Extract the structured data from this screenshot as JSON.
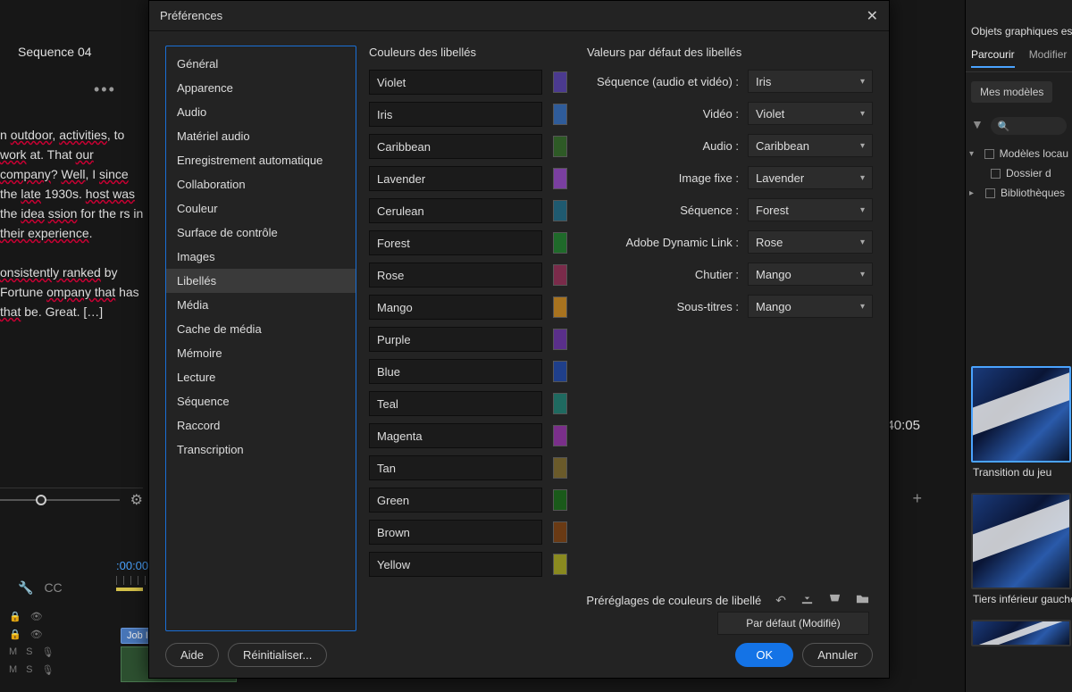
{
  "bg": {
    "sequence_tab": "Sequence 04",
    "ellipsis": "•••",
    "text_html": "n <u>outdoor</u>, <u>activities</u>, to <u>work</u> at. That <u>our company</u>? <u>Well</u>, I <u>since</u> the <u>late</u> 1930s. <u>host was</u> the <u>idea</u> <u>ssion</u> for the rs in <u>their experience</u>.<br><br><u>onsistently ranked</u> by Fortune <u>ompany that</u> has <u>that</u> be. Great. […]",
    "timecode": ":00:00",
    "right_time": "40:05",
    "tools": {
      "wrench": "🔧",
      "cc": "CC"
    },
    "clip1": "Job In",
    "track_letters": [
      "M",
      "S"
    ]
  },
  "right": {
    "header": "Objets graphiques essen",
    "tabs": {
      "browse": "Parcourir",
      "edit": "Modifier"
    },
    "btn_models": "Mes modèles",
    "search_placeholder": "",
    "tree": {
      "item1": "Modèles locau",
      "item1a": "Dossier d",
      "item2": "Bibliothèques"
    },
    "thumb1": "Transition du jeu",
    "thumb2": "Tiers inférieur gauche"
  },
  "dialog": {
    "title": "Préférences",
    "sidebar": [
      "Général",
      "Apparence",
      "Audio",
      "Matériel audio",
      "Enregistrement automatique",
      "Collaboration",
      "Couleur",
      "Surface de contrôle",
      "Images",
      "Libellés",
      "Média",
      "Cache de média",
      "Mémoire",
      "Lecture",
      "Séquence",
      "Raccord",
      "Transcription"
    ],
    "sidebar_selected": 9,
    "col_colors_title": "Couleurs des libellés",
    "colors": [
      {
        "name": "Violet",
        "hex": "#4b3a8f"
      },
      {
        "name": "Iris",
        "hex": "#2f5c9a"
      },
      {
        "name": "Caribbean",
        "hex": "#2e5a26"
      },
      {
        "name": "Lavender",
        "hex": "#7a3fa0"
      },
      {
        "name": "Cerulean",
        "hex": "#1f5a70"
      },
      {
        "name": "Forest",
        "hex": "#1f6a2a"
      },
      {
        "name": "Rose",
        "hex": "#7a2b4a"
      },
      {
        "name": "Mango",
        "hex": "#a8731f"
      },
      {
        "name": "Purple",
        "hex": "#5a2f8a"
      },
      {
        "name": "Blue",
        "hex": "#1f3f8a"
      },
      {
        "name": "Teal",
        "hex": "#1f6a60"
      },
      {
        "name": "Magenta",
        "hex": "#7a2f8a"
      },
      {
        "name": "Tan",
        "hex": "#6a5a2a"
      },
      {
        "name": "Green",
        "hex": "#1a5a1a"
      },
      {
        "name": "Brown",
        "hex": "#6a3a14"
      },
      {
        "name": "Yellow",
        "hex": "#8a8a20"
      }
    ],
    "col_defaults_title": "Valeurs par défaut des libellés",
    "defaults": [
      {
        "label": "Séquence (audio et vidéo) :",
        "value": "Iris"
      },
      {
        "label": "Vidéo :",
        "value": "Violet"
      },
      {
        "label": "Audio :",
        "value": "Caribbean"
      },
      {
        "label": "Image fixe :",
        "value": "Lavender"
      },
      {
        "label": "Séquence :",
        "value": "Forest"
      },
      {
        "label": "Adobe Dynamic Link :",
        "value": "Rose"
      },
      {
        "label": "Chutier :",
        "value": "Mango"
      },
      {
        "label": "Sous-titres :",
        "value": "Mango"
      }
    ],
    "preset_label": "Préréglages de couleurs de libellé",
    "preset_value": "Par défaut (Modifié)",
    "buttons": {
      "help": "Aide",
      "reset": "Réinitialiser...",
      "ok": "OK",
      "cancel": "Annuler"
    }
  }
}
